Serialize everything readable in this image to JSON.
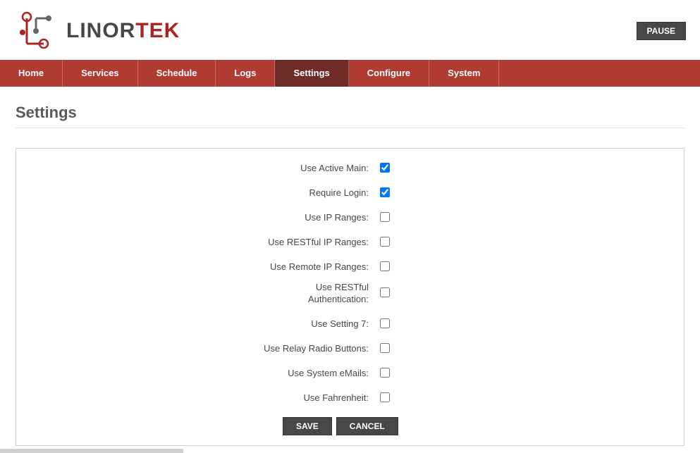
{
  "header": {
    "brand_prefix": "LINOR",
    "brand_suffix": "TEK",
    "pause_label": "PAUSE"
  },
  "nav": {
    "items": [
      {
        "label": "Home",
        "active": false
      },
      {
        "label": "Services",
        "active": false
      },
      {
        "label": "Schedule",
        "active": false
      },
      {
        "label": "Logs",
        "active": false
      },
      {
        "label": "Settings",
        "active": true
      },
      {
        "label": "Configure",
        "active": false
      },
      {
        "label": "System",
        "active": false
      }
    ]
  },
  "page": {
    "title": "Settings"
  },
  "settings": {
    "fields": [
      {
        "label": "Use Active Main:",
        "checked": true
      },
      {
        "label": "Require Login:",
        "checked": true
      },
      {
        "label": "Use IP Ranges:",
        "checked": false
      },
      {
        "label": "Use RESTful IP Ranges:",
        "checked": false
      },
      {
        "label": "Use Remote IP Ranges:",
        "checked": false
      },
      {
        "label": "Use RESTful Authentication:",
        "checked": false
      },
      {
        "label": "Use Setting 7:",
        "checked": false
      },
      {
        "label": "Use Relay Radio Buttons:",
        "checked": false
      },
      {
        "label": "Use System eMails:",
        "checked": false
      },
      {
        "label": "Use Fahrenheit:",
        "checked": false
      }
    ],
    "save_label": "SAVE",
    "cancel_label": "CANCEL"
  }
}
